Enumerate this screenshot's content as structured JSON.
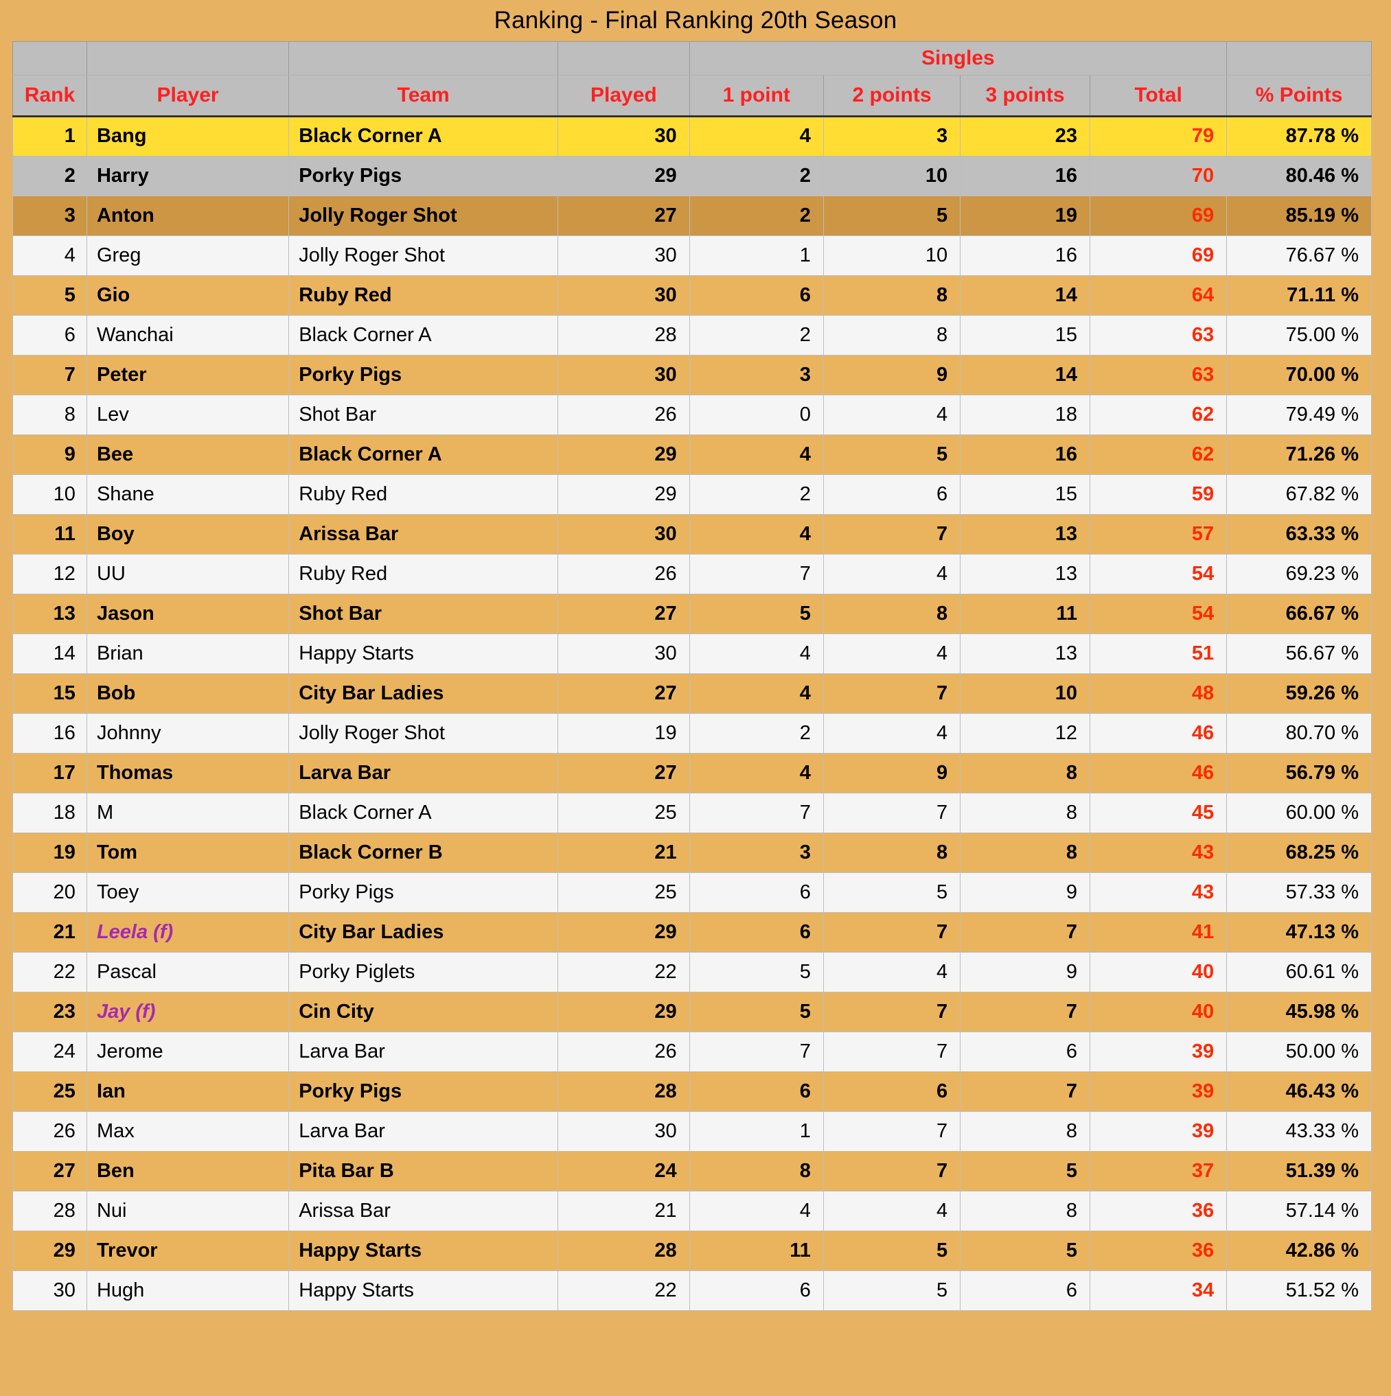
{
  "title": "Ranking  -  Final Ranking 20th Season",
  "table": {
    "group_header": {
      "blank_rank": "",
      "blank_player": "",
      "blank_team": "",
      "blank_played": "",
      "singles": "Singles",
      "blank_pct": ""
    },
    "columns": [
      "Rank",
      "Player",
      "Team",
      "Played",
      "1 point",
      "2 points",
      "3 points",
      "Total",
      "% Points"
    ],
    "rows": [
      {
        "rank": "1",
        "player": "Bang",
        "female": false,
        "team": "Black Corner A",
        "played": "30",
        "p1": "4",
        "p2": "3",
        "p3": "23",
        "total": "79",
        "pct": "87.78 %",
        "style": "gold"
      },
      {
        "rank": "2",
        "player": "Harry",
        "female": false,
        "team": "Porky Pigs",
        "played": "29",
        "p1": "2",
        "p2": "10",
        "p3": "16",
        "total": "70",
        "pct": "80.46 %",
        "style": "silver"
      },
      {
        "rank": "3",
        "player": "Anton",
        "female": false,
        "team": "Jolly Roger Shot",
        "played": "27",
        "p1": "2",
        "p2": "5",
        "p3": "19",
        "total": "69",
        "pct": "85.19 %",
        "style": "bronze"
      },
      {
        "rank": "4",
        "player": "Greg",
        "female": false,
        "team": "Jolly Roger Shot",
        "played": "30",
        "p1": "1",
        "p2": "10",
        "p3": "16",
        "total": "69",
        "pct": "76.67 %",
        "style": "even"
      },
      {
        "rank": "5",
        "player": "Gio",
        "female": false,
        "team": "Ruby Red",
        "played": "30",
        "p1": "6",
        "p2": "8",
        "p3": "14",
        "total": "64",
        "pct": "71.11 %",
        "style": "odd"
      },
      {
        "rank": "6",
        "player": "Wanchai",
        "female": false,
        "team": "Black Corner A",
        "played": "28",
        "p1": "2",
        "p2": "8",
        "p3": "15",
        "total": "63",
        "pct": "75.00 %",
        "style": "even"
      },
      {
        "rank": "7",
        "player": "Peter",
        "female": false,
        "team": "Porky Pigs",
        "played": "30",
        "p1": "3",
        "p2": "9",
        "p3": "14",
        "total": "63",
        "pct": "70.00 %",
        "style": "odd"
      },
      {
        "rank": "8",
        "player": "Lev",
        "female": false,
        "team": "Shot Bar",
        "played": "26",
        "p1": "0",
        "p2": "4",
        "p3": "18",
        "total": "62",
        "pct": "79.49 %",
        "style": "even"
      },
      {
        "rank": "9",
        "player": "Bee",
        "female": false,
        "team": "Black Corner A",
        "played": "29",
        "p1": "4",
        "p2": "5",
        "p3": "16",
        "total": "62",
        "pct": "71.26 %",
        "style": "odd"
      },
      {
        "rank": "10",
        "player": "Shane",
        "female": false,
        "team": "Ruby Red",
        "played": "29",
        "p1": "2",
        "p2": "6",
        "p3": "15",
        "total": "59",
        "pct": "67.82 %",
        "style": "even"
      },
      {
        "rank": "11",
        "player": "Boy",
        "female": false,
        "team": "Arissa Bar",
        "played": "30",
        "p1": "4",
        "p2": "7",
        "p3": "13",
        "total": "57",
        "pct": "63.33 %",
        "style": "odd"
      },
      {
        "rank": "12",
        "player": "UU",
        "female": false,
        "team": "Ruby Red",
        "played": "26",
        "p1": "7",
        "p2": "4",
        "p3": "13",
        "total": "54",
        "pct": "69.23 %",
        "style": "even"
      },
      {
        "rank": "13",
        "player": "Jason",
        "female": false,
        "team": "Shot Bar",
        "played": "27",
        "p1": "5",
        "p2": "8",
        "p3": "11",
        "total": "54",
        "pct": "66.67 %",
        "style": "odd"
      },
      {
        "rank": "14",
        "player": "Brian",
        "female": false,
        "team": "Happy Starts",
        "played": "30",
        "p1": "4",
        "p2": "4",
        "p3": "13",
        "total": "51",
        "pct": "56.67 %",
        "style": "even"
      },
      {
        "rank": "15",
        "player": "Bob",
        "female": false,
        "team": "City Bar Ladies",
        "played": "27",
        "p1": "4",
        "p2": "7",
        "p3": "10",
        "total": "48",
        "pct": "59.26 %",
        "style": "odd"
      },
      {
        "rank": "16",
        "player": "Johnny",
        "female": false,
        "team": "Jolly Roger Shot",
        "played": "19",
        "p1": "2",
        "p2": "4",
        "p3": "12",
        "total": "46",
        "pct": "80.70 %",
        "style": "even"
      },
      {
        "rank": "17",
        "player": "Thomas",
        "female": false,
        "team": "Larva Bar",
        "played": "27",
        "p1": "4",
        "p2": "9",
        "p3": "8",
        "total": "46",
        "pct": "56.79 %",
        "style": "odd"
      },
      {
        "rank": "18",
        "player": "M",
        "female": false,
        "team": "Black Corner A",
        "played": "25",
        "p1": "7",
        "p2": "7",
        "p3": "8",
        "total": "45",
        "pct": "60.00 %",
        "style": "even"
      },
      {
        "rank": "19",
        "player": "Tom",
        "female": false,
        "team": "Black Corner B",
        "played": "21",
        "p1": "3",
        "p2": "8",
        "p3": "8",
        "total": "43",
        "pct": "68.25 %",
        "style": "odd"
      },
      {
        "rank": "20",
        "player": "Toey",
        "female": false,
        "team": "Porky Pigs",
        "played": "25",
        "p1": "6",
        "p2": "5",
        "p3": "9",
        "total": "43",
        "pct": "57.33 %",
        "style": "even"
      },
      {
        "rank": "21",
        "player": "Leela (f)",
        "female": true,
        "team": "City Bar Ladies",
        "played": "29",
        "p1": "6",
        "p2": "7",
        "p3": "7",
        "total": "41",
        "pct": "47.13 %",
        "style": "odd"
      },
      {
        "rank": "22",
        "player": "Pascal",
        "female": false,
        "team": "Porky Piglets",
        "played": "22",
        "p1": "5",
        "p2": "4",
        "p3": "9",
        "total": "40",
        "pct": "60.61 %",
        "style": "even"
      },
      {
        "rank": "23",
        "player": "Jay (f)",
        "female": true,
        "team": "Cin City",
        "played": "29",
        "p1": "5",
        "p2": "7",
        "p3": "7",
        "total": "40",
        "pct": "45.98 %",
        "style": "odd"
      },
      {
        "rank": "24",
        "player": "Jerome",
        "female": false,
        "team": "Larva Bar",
        "played": "26",
        "p1": "7",
        "p2": "7",
        "p3": "6",
        "total": "39",
        "pct": "50.00 %",
        "style": "even"
      },
      {
        "rank": "25",
        "player": "Ian",
        "female": false,
        "team": "Porky Pigs",
        "played": "28",
        "p1": "6",
        "p2": "6",
        "p3": "7",
        "total": "39",
        "pct": "46.43 %",
        "style": "odd"
      },
      {
        "rank": "26",
        "player": "Max",
        "female": false,
        "team": "Larva Bar",
        "played": "30",
        "p1": "1",
        "p2": "7",
        "p3": "8",
        "total": "39",
        "pct": "43.33 %",
        "style": "even"
      },
      {
        "rank": "27",
        "player": "Ben",
        "female": false,
        "team": "Pita Bar B",
        "played": "24",
        "p1": "8",
        "p2": "7",
        "p3": "5",
        "total": "37",
        "pct": "51.39 %",
        "style": "odd"
      },
      {
        "rank": "28",
        "player": "Nui",
        "female": false,
        "team": "Arissa Bar",
        "played": "21",
        "p1": "4",
        "p2": "4",
        "p3": "8",
        "total": "36",
        "pct": "57.14 %",
        "style": "even"
      },
      {
        "rank": "29",
        "player": "Trevor",
        "female": false,
        "team": "Happy Starts",
        "played": "28",
        "p1": "11",
        "p2": "5",
        "p3": "5",
        "total": "36",
        "pct": "42.86 %",
        "style": "odd"
      },
      {
        "rank": "30",
        "player": "Hugh",
        "female": false,
        "team": "Happy Starts",
        "played": "22",
        "p1": "6",
        "p2": "5",
        "p3": "6",
        "total": "34",
        "pct": "51.52 %",
        "style": "even"
      }
    ]
  },
  "colors": {
    "page_background": "#e8b263",
    "header_background": "#bebebe",
    "header_text": "#ff2020",
    "gold_row": "#ffdd33",
    "silver_row": "#bfbfbf",
    "bronze_row": "#cc9644",
    "odd_row": "#eab45e",
    "even_row": "#f5f5f5",
    "total_text": "#ff2a00",
    "female_text": "#a32bb0"
  }
}
